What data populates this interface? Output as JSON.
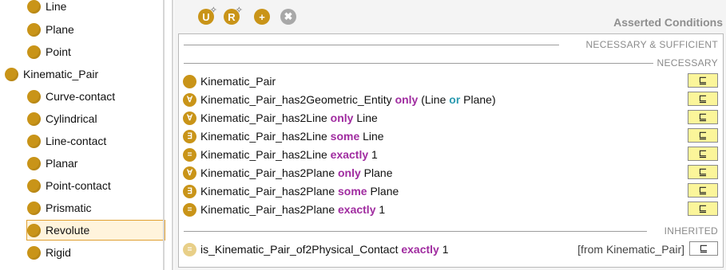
{
  "tree": {
    "items": [
      {
        "label": "Line"
      },
      {
        "label": "Plane"
      },
      {
        "label": "Point"
      },
      {
        "label": "Kinematic_Pair"
      },
      {
        "label": "Curve-contact"
      },
      {
        "label": "Cylindrical"
      },
      {
        "label": "Line-contact"
      },
      {
        "label": "Planar"
      },
      {
        "label": "Point-contact"
      },
      {
        "label": "Prismatic"
      },
      {
        "label": "Revolute",
        "selected": true
      },
      {
        "label": "Rigid"
      }
    ]
  },
  "toolbar": {
    "buttons": [
      {
        "icon": "add-named-class-icon",
        "glyph": "U"
      },
      {
        "icon": "add-restriction-icon",
        "glyph": "R"
      },
      {
        "icon": "create-class-icon",
        "glyph": "+"
      },
      {
        "icon": "delete-condition-icon",
        "glyph": "✖"
      }
    ]
  },
  "panel": {
    "title": "Asserted Conditions",
    "sections": {
      "necessary_sufficient": "NECESSARY & SUFFICIENT",
      "necessary": "NECESSARY",
      "inherited": "INHERITED"
    },
    "subclass_symbol": "⊑",
    "conditions": [
      {
        "icon": "named-class-icon",
        "glyph": "",
        "class": "Kinematic_Pair"
      },
      {
        "icon": "universal-restriction-icon",
        "glyph": "∀",
        "property": "Kinematic_Pair_has2Geometric_Entity",
        "quantifier": "only",
        "filler_prefix": "(Line",
        "filler_op": "or",
        "filler_suffix": "Plane)"
      },
      {
        "icon": "universal-restriction-icon",
        "glyph": "∀",
        "property": "Kinematic_Pair_has2Line",
        "quantifier": "only",
        "filler": "Line"
      },
      {
        "icon": "existential-restriction-icon",
        "glyph": "∃",
        "property": "Kinematic_Pair_has2Line",
        "quantifier": "some",
        "filler": "Line"
      },
      {
        "icon": "cardinality-restriction-icon",
        "glyph": "=",
        "property": "Kinematic_Pair_has2Line",
        "quantifier": "exactly",
        "filler": "1"
      },
      {
        "icon": "universal-restriction-icon",
        "glyph": "∀",
        "property": "Kinematic_Pair_has2Plane",
        "quantifier": "only",
        "filler": "Plane"
      },
      {
        "icon": "existential-restriction-icon",
        "glyph": "∃",
        "property": "Kinematic_Pair_has2Plane",
        "quantifier": "some",
        "filler": "Plane"
      },
      {
        "icon": "cardinality-restriction-icon",
        "glyph": "=",
        "property": "Kinematic_Pair_has2Plane",
        "quantifier": "exactly",
        "filler": "1"
      }
    ],
    "inherited": [
      {
        "icon": "cardinality-restriction-icon",
        "glyph": "=",
        "property": "is_Kinematic_Pair_of2Physical_Contact",
        "quantifier": "exactly",
        "filler": "1",
        "from": "[from Kinematic_Pair]"
      }
    ]
  },
  "colors": {
    "class_icon": "#c99418",
    "keyword": "#a02ca0",
    "or_keyword": "#2a9ab0",
    "subclass_button": "#fbf59a"
  }
}
